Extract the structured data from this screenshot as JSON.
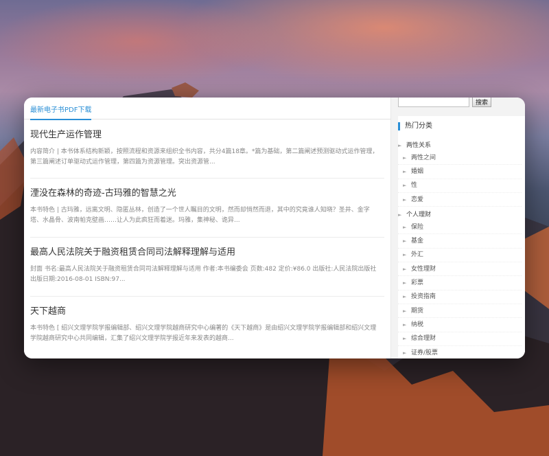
{
  "tab": {
    "label": "最新电子书PDF下载"
  },
  "articles": [
    {
      "title": "现代生产运作管理",
      "excerpt": "内容简介 | 本书体系结构新颖，按照流程和资源来组织全书内容，共分4篇18章。*篇为基础，第二篇阐述预测驱动式运作管理，第三篇阐述订单驱动式运作管理，第四篇为资源管理。突出资源管..."
    },
    {
      "title": "湮没在森林的奇迹-古玛雅的智慧之光",
      "excerpt": "本书特色 | 古玛雅，远离文明、隐匿丛林，创造了一个世人瞩目的文明，然而却悄然而退，其中的究竟谁人知晓？圣井、金字塔、水晶骨、波南帕克壁画……让人为此疯狂而着迷。玛雅，集神秘、诡异..."
    },
    {
      "title": "最高人民法院关于融资租赁合同司法解释理解与适用",
      "excerpt": "封面 书名:最高人民法院关于融资租赁合同司法解释理解与适用 作者:本书编委会 页数:482 定价:¥86.0 出版社:人民法院出版社 出版日期:2016-08-01 ISBN:97..."
    },
    {
      "title": "天下越商",
      "excerpt": "本书特色 [ 绍兴文理学院学报编辑部、绍兴文理学院越商研究中心编著的《天下越商》是由绍兴文理学院学报编辑部和绍兴文理学院越商研究中心共同编辑，汇集了绍兴文理学院学报近年来发表的越商..."
    }
  ],
  "search": {
    "button_label": "搜索",
    "placeholder": ""
  },
  "sidebar": {
    "hot_title": "热门分类",
    "groups": [
      {
        "label": "两性关系",
        "children": [
          "两性之间",
          "婚姻",
          "性",
          "恋爱"
        ]
      },
      {
        "label": "个人理财",
        "children": [
          "保险",
          "基金",
          "外汇",
          "女性理财",
          "彩票",
          "投资指南",
          "期货",
          "纳税",
          "综合理财",
          "证券/股票"
        ]
      }
    ]
  }
}
